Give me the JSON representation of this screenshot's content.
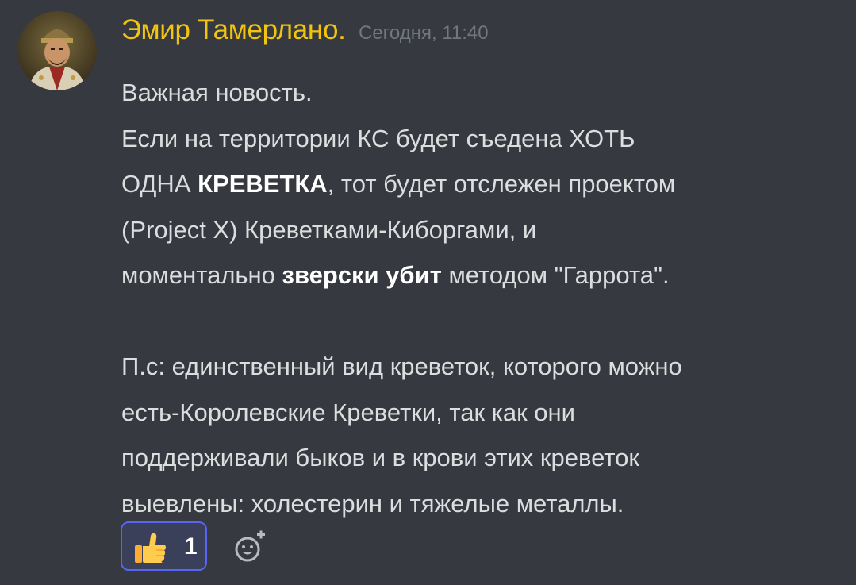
{
  "message": {
    "author": "Эмир Тамерлано.",
    "timestamp": "Сегодня, 11:40",
    "lines": [
      [
        {
          "t": "Важная новость."
        }
      ],
      [
        {
          "t": "Если на территории КС будет съедена ХОТЬ"
        }
      ],
      [
        {
          "t": "ОДНА "
        },
        {
          "t": "КРЕВЕТКА",
          "b": true
        },
        {
          "t": ", тот будет отслежен проектом"
        }
      ],
      [
        {
          "t": "(Project X) Креветками-Киборгами, и"
        }
      ],
      [
        {
          "t": "моментально "
        },
        {
          "t": "зверски убит",
          "b": true
        },
        {
          "t": " методом \"Гаррота\"."
        }
      ],
      [],
      [
        {
          "t": "П.с: единственный вид креветок, которого можно"
        }
      ],
      [
        {
          "t": "есть-Королевские Креветки, так как они"
        }
      ],
      [
        {
          "t": "поддерживали быков и в крови этих креветок"
        }
      ],
      [
        {
          "t": "выевлены: холестерин и тяжелые металлы."
        }
      ]
    ]
  },
  "reactions": [
    {
      "emoji": "thumbs-up-icon",
      "count": "1",
      "active": true
    }
  ],
  "add_reaction": {
    "icon": "add-reaction-icon"
  },
  "colors": {
    "background": "#36393f",
    "author": "#f1c40f",
    "timestamp": "#72767d",
    "text": "#dcddde",
    "reaction_border": "#5865f2",
    "reaction_bg": "#3b405a"
  }
}
